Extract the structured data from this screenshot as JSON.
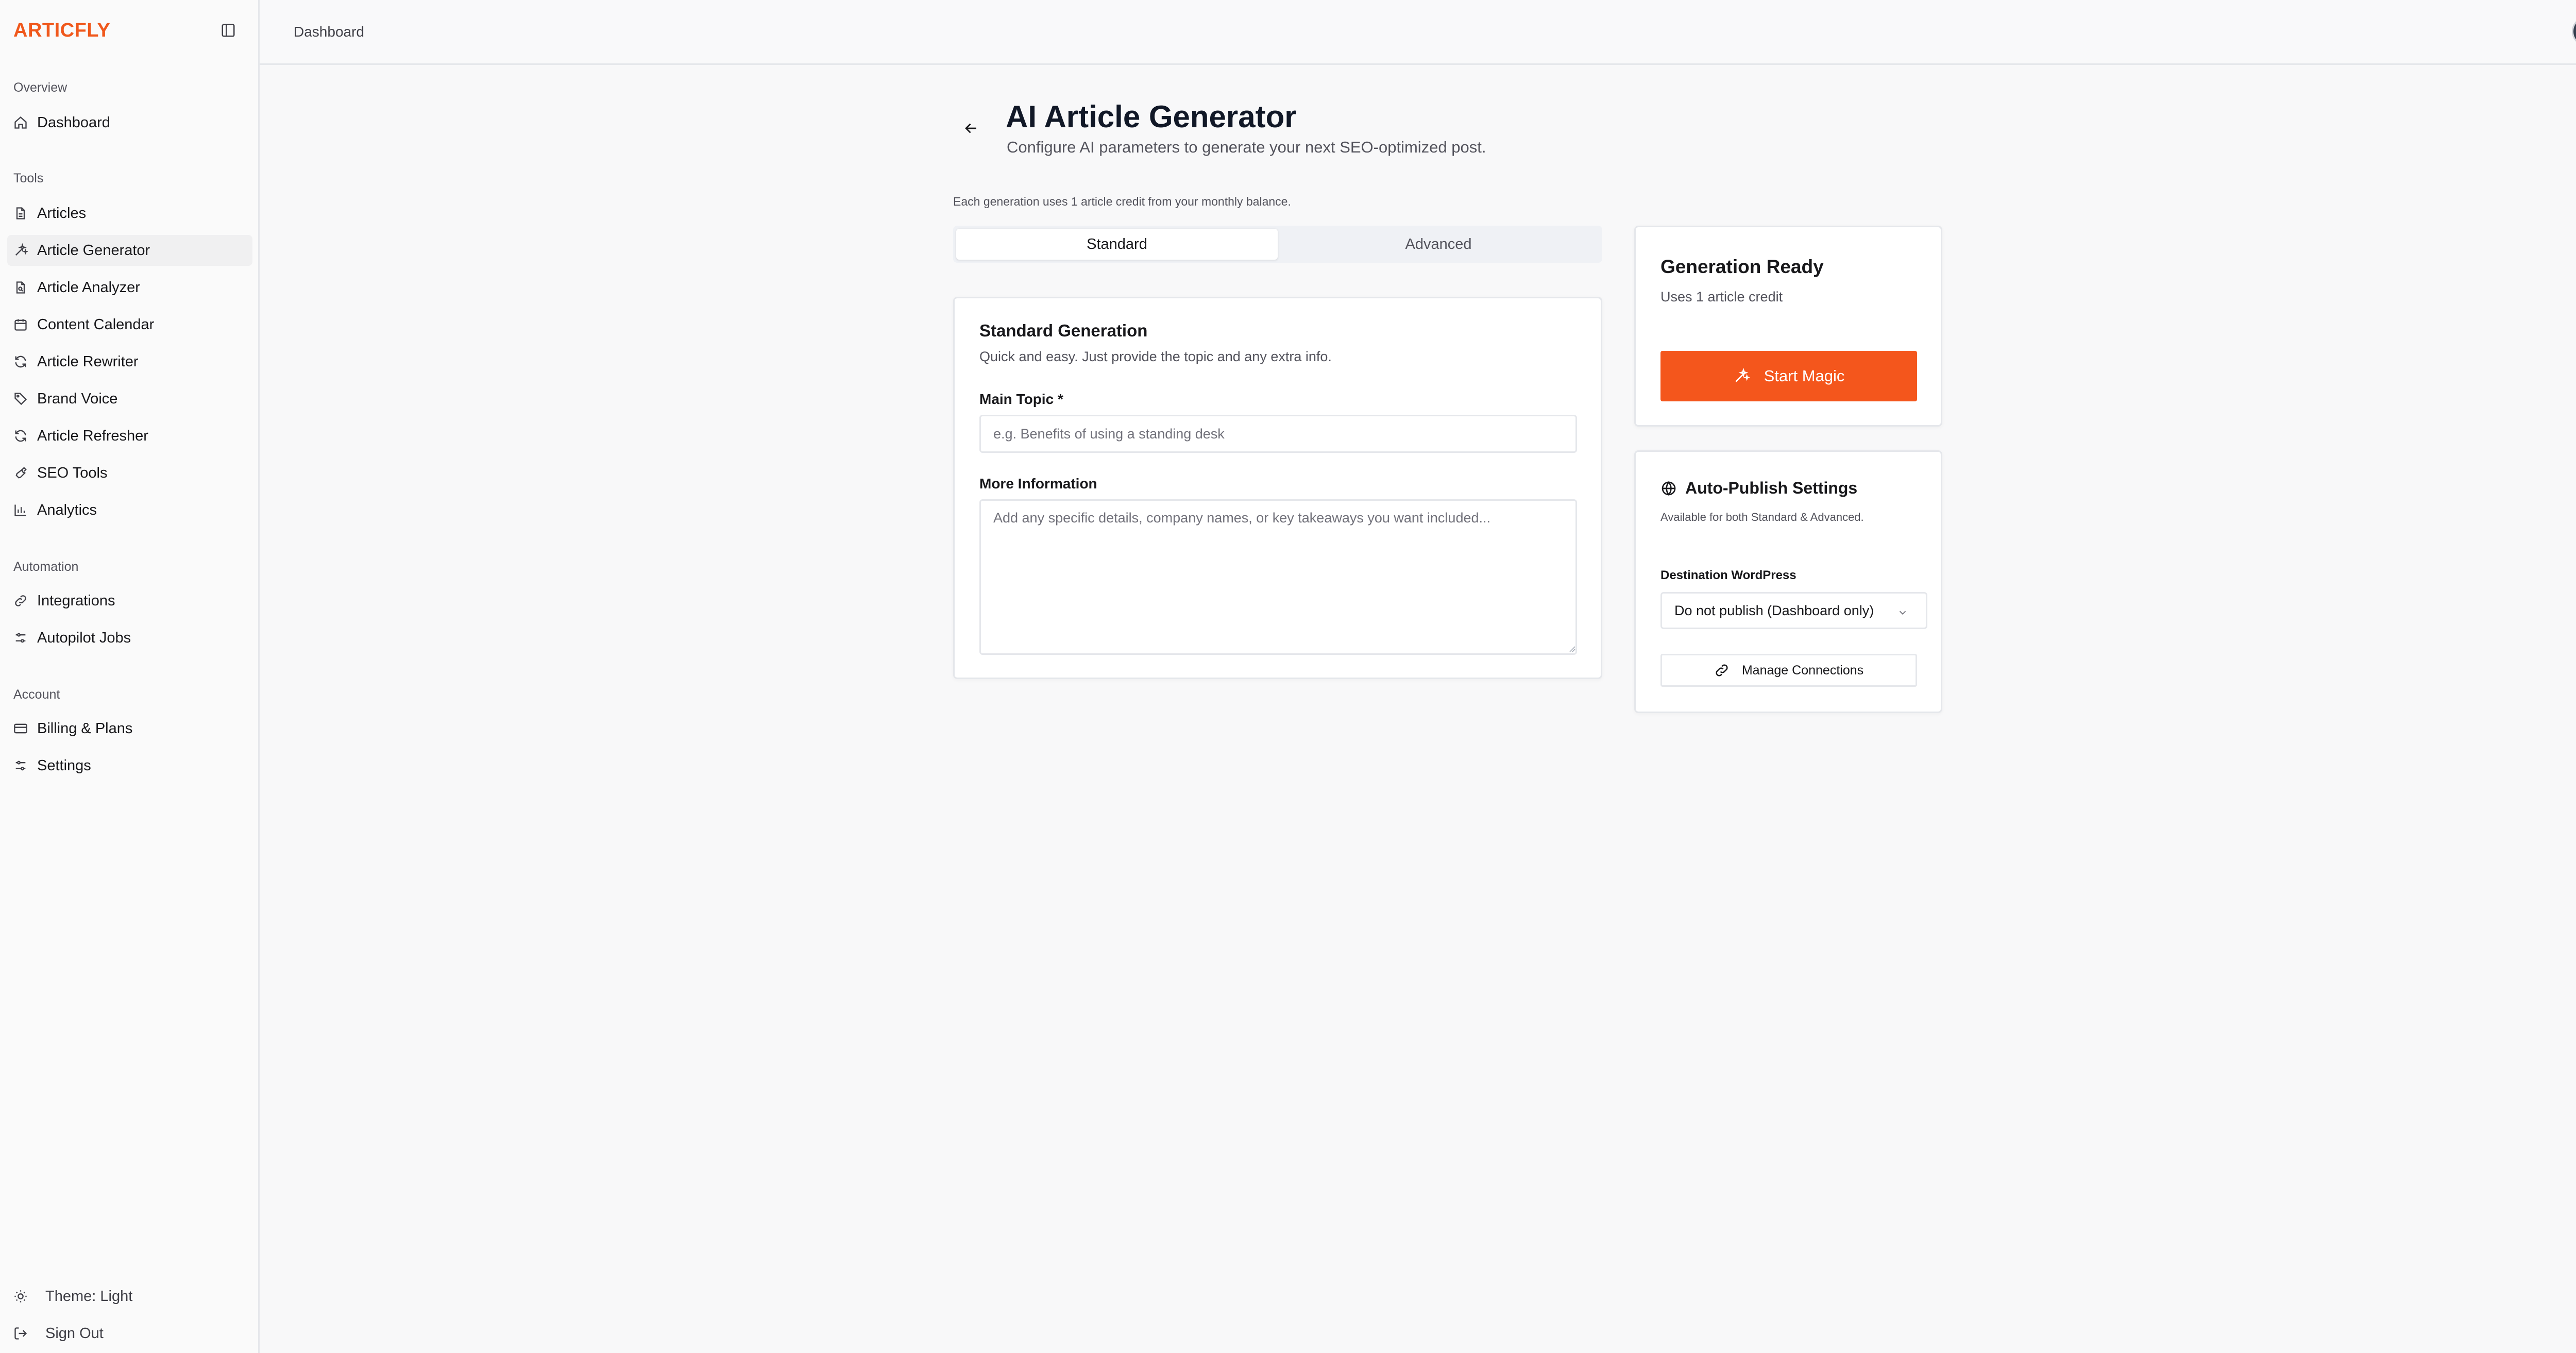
{
  "brand": "ARTICFLY",
  "sidebar": {
    "sections": [
      {
        "label": "Overview",
        "items": [
          {
            "label": "Dashboard",
            "icon": "home-icon"
          }
        ]
      },
      {
        "label": "Tools",
        "items": [
          {
            "label": "Articles",
            "icon": "file-text-icon"
          },
          {
            "label": "Article Generator",
            "icon": "sparkles-icon",
            "active": true
          },
          {
            "label": "Article Analyzer",
            "icon": "file-search-icon"
          },
          {
            "label": "Content Calendar",
            "icon": "calendar-icon"
          },
          {
            "label": "Article Rewriter",
            "icon": "refresh-icon"
          },
          {
            "label": "Brand Voice",
            "icon": "tag-icon"
          },
          {
            "label": "Article Refresher",
            "icon": "refresh-icon"
          },
          {
            "label": "SEO Tools",
            "icon": "wrench-icon"
          },
          {
            "label": "Analytics",
            "icon": "bar-chart-icon"
          }
        ]
      },
      {
        "label": "Automation",
        "items": [
          {
            "label": "Integrations",
            "icon": "link-icon"
          },
          {
            "label": "Autopilot Jobs",
            "icon": "sliders-icon"
          }
        ]
      },
      {
        "label": "Account",
        "items": [
          {
            "label": "Billing & Plans",
            "icon": "credit-card-icon"
          },
          {
            "label": "Settings",
            "icon": "sliders-icon"
          }
        ]
      }
    ],
    "footer": {
      "theme": "Theme: Light",
      "signout": "Sign Out"
    }
  },
  "topbar": {
    "breadcrumb": "Dashboard"
  },
  "page": {
    "title": "AI Article Generator",
    "subtitle": "Configure AI parameters to generate your next SEO-optimized post.",
    "credit_note": "Each generation uses 1 article credit from your monthly balance."
  },
  "tabs": [
    {
      "label": "Standard",
      "active": true
    },
    {
      "label": "Advanced",
      "active": false
    }
  ],
  "standard": {
    "title": "Standard Generation",
    "subtitle": "Quick and easy. Just provide the topic and any extra info.",
    "topic_label": "Main Topic *",
    "topic_placeholder": "e.g. Benefits of using a standing desk",
    "topic_value": "",
    "info_label": "More Information",
    "info_placeholder": "Add any specific details, company names, or key takeaways you want included...",
    "info_value": ""
  },
  "ready": {
    "title": "Generation Ready",
    "subtitle": "Uses 1 article credit",
    "button": "Start Magic"
  },
  "autopublish": {
    "title": "Auto-Publish Settings",
    "subtitle": "Available for both Standard & Advanced.",
    "dest_label": "Destination WordPress",
    "dest_value": "Do not publish (Dashboard only)",
    "manage_button": "Manage Connections"
  },
  "colors": {
    "accent": "#f4561c",
    "brand": "#f0581c",
    "background": "#f8f8f9"
  }
}
